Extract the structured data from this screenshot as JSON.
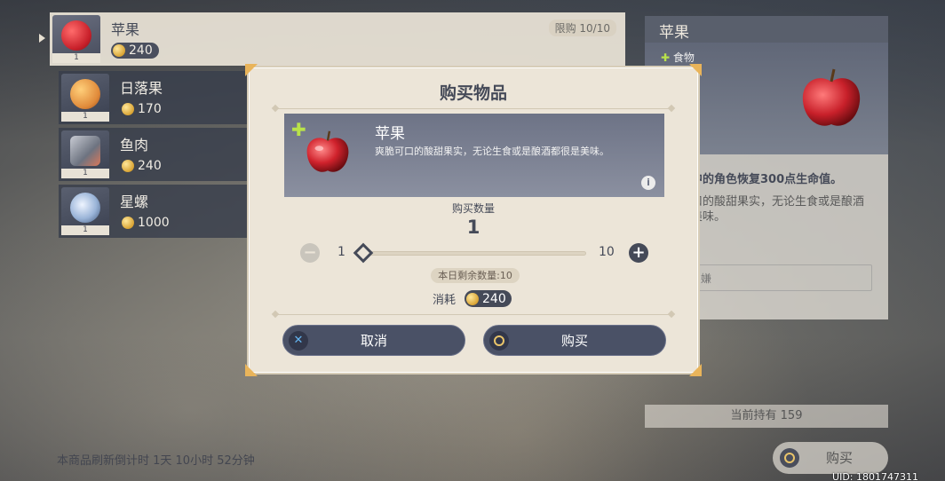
{
  "shop_list": {
    "items": [
      {
        "name": "苹果",
        "price": "240",
        "count": "1",
        "limit": "限购 10/10",
        "color": "#c8202a"
      },
      {
        "name": "日落果",
        "price": "170",
        "count": "1",
        "color": "#e08a3a"
      },
      {
        "name": "鱼肉",
        "price": "240",
        "count": "1",
        "color": "#7a7f8a"
      },
      {
        "name": "星螺",
        "price": "1000",
        "count": "1",
        "color": "#9ab4d8"
      }
    ],
    "refresh_text": "本商品刷新倒计时 1天 10小时 52分钟"
  },
  "detail_panel": {
    "title": "苹果",
    "category": "食物",
    "effect": "中的角色恢复300点生命值。",
    "desc": "口的酸甜果实，无论生食或是酿酒\n美味。",
    "box_text": "嫌",
    "owned": "当前持有 159",
    "buy_label": "购买"
  },
  "dialog": {
    "title": "购买物品",
    "item_name": "苹果",
    "item_desc": "爽脆可口的酸甜果实，无论生食或是酿酒都很是美味。",
    "info_icon": "i",
    "quantity_label": "购买数量",
    "quantity": "1",
    "quantity_fraction": 0,
    "min": "1",
    "max": "10",
    "remaining": "本日剩余数量:10",
    "cost_label": "消耗",
    "cost": "240",
    "cancel_label": "取消",
    "confirm_label": "购买"
  },
  "uid": "UID: 1801747311",
  "colors": {
    "accent_dark": "#454a58",
    "cream": "#ece5d8",
    "gold": "#e9b45a"
  }
}
